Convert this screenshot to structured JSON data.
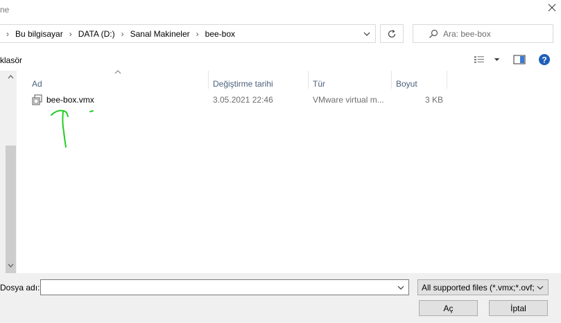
{
  "window": {
    "title_fragment": "ne"
  },
  "address_bar": {
    "crumbs": [
      "Bu bilgisayar",
      "DATA (D:)",
      "Sanal Makineler",
      "bee-box"
    ]
  },
  "search": {
    "placeholder": "Ara: bee-box"
  },
  "toolbar": {
    "new_folder_label": "klasör"
  },
  "columns": {
    "name": "Ad",
    "modified": "Değiştirme tarihi",
    "type": "Tür",
    "size": "Boyut"
  },
  "files": [
    {
      "name": "bee-box.vmx",
      "modified": "3.05.2021 22:46",
      "type": "VMware virtual m...",
      "size": "3 KB"
    }
  ],
  "footer": {
    "filename_label": "Dosya adı:",
    "filename_value": "",
    "filter_value": "All supported files (*.vmx;*.ovf;",
    "open_label": "Aç",
    "cancel_label": "İptal"
  },
  "colors": {
    "annotation": "#22cc22",
    "header_text": "#4c607a",
    "help_blue": "#1e5fb8"
  },
  "icons": [
    "close-icon",
    "chevron-right-icon",
    "chevron-down-icon",
    "refresh-icon",
    "search-icon",
    "view-options-icon",
    "preview-pane-icon",
    "help-icon",
    "file-icon",
    "sort-up-icon",
    "scroll-up-icon",
    "scroll-down-icon"
  ]
}
